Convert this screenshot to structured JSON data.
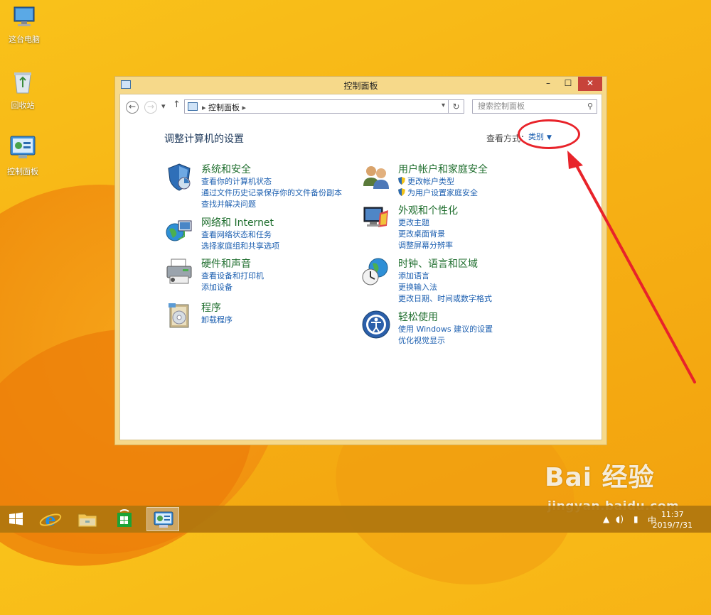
{
  "desktop": {
    "icons": [
      {
        "label": "这台电脑",
        "icon": "computer-icon"
      },
      {
        "label": "回收站",
        "icon": "recycle-bin-icon"
      },
      {
        "label": "控制面板",
        "icon": "control-panel-icon"
      }
    ]
  },
  "window": {
    "title": "控制面板",
    "buttons": {
      "minimize": "–",
      "maximize": "☐",
      "close": "✕"
    }
  },
  "navbar": {
    "breadcrumb": "控制面板",
    "search_placeholder": "搜索控制面板"
  },
  "content": {
    "heading": "调整计算机的设置",
    "view_by_label": "查看方式：",
    "view_by_value": "类别"
  },
  "categories": {
    "left": [
      {
        "title": "系统和安全",
        "icon": "shield-icon",
        "links": [
          "查看你的计算机状态",
          "通过文件历史记录保存你的文件备份副本",
          "查找并解决问题"
        ]
      },
      {
        "title": "网络和 Internet",
        "icon": "network-globe-icon",
        "links": [
          "查看网络状态和任务",
          "选择家庭组和共享选项"
        ]
      },
      {
        "title": "硬件和声音",
        "icon": "printer-icon",
        "links": [
          "查看设备和打印机",
          "添加设备"
        ]
      },
      {
        "title": "程序",
        "icon": "programs-icon",
        "links": [
          "卸载程序"
        ]
      }
    ],
    "right": [
      {
        "title": "用户帐户和家庭安全",
        "icon": "users-icon",
        "links": [
          "更改帐户类型",
          "为用户设置家庭安全"
        ]
      },
      {
        "title": "外观和个性化",
        "icon": "display-icon",
        "links": [
          "更改主题",
          "更改桌面背景",
          "调整屏幕分辨率"
        ]
      },
      {
        "title": "时钟、语言和区域",
        "icon": "clock-globe-icon",
        "links": [
          "添加语言",
          "更换输入法",
          "更改日期、时间或数字格式"
        ]
      },
      {
        "title": "轻松使用",
        "icon": "ease-of-access-icon",
        "links": [
          "使用 Windows 建议的设置",
          "优化视觉显示"
        ]
      }
    ]
  },
  "watermark": {
    "brand": "Bai 经验",
    "url": "jingyan.baidu.com"
  },
  "taskbar": {
    "items": [
      "start-icon",
      "internet-explorer-icon",
      "file-explorer-icon",
      "store-icon",
      "control-panel-icon"
    ],
    "tray": {
      "ime": "中",
      "time": "11:37",
      "date": "2019/7/31"
    }
  },
  "colors": {
    "accent_link": "#1c5fb0",
    "category_title": "#1f6e2e",
    "close_button": "#c7433a",
    "annotation": "#e8232a"
  }
}
